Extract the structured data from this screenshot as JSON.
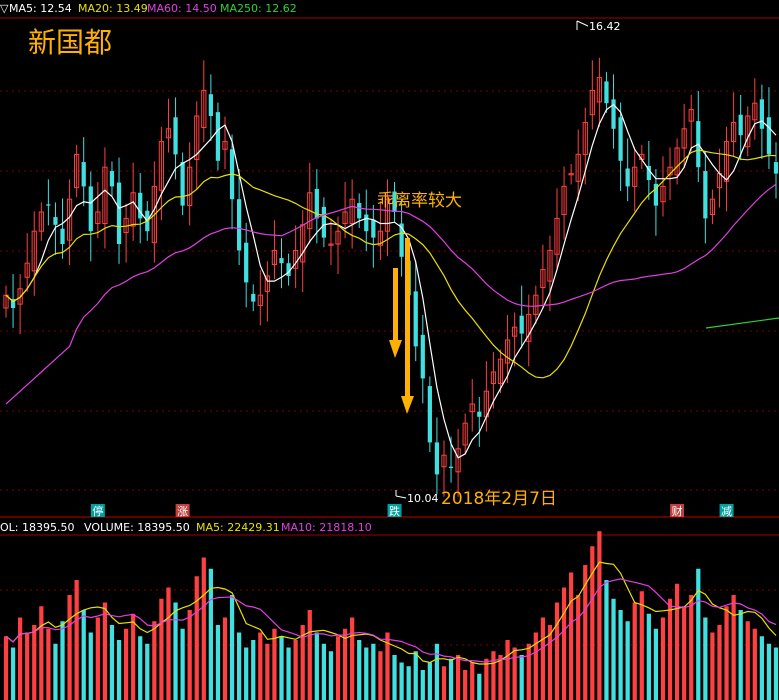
{
  "stock_name": "新国都",
  "annotations": {
    "deviation_note": "乖离率较大",
    "date_note": "2018年2月7日",
    "high_label": "16.42",
    "low_label": "10.04"
  },
  "price_header": {
    "prefix": "▽",
    "ma5": "MA5: 12.54",
    "ma20": "MA20: 13.49",
    "ma60": "MA60: 14.50",
    "ma250": "MA250: 12.62"
  },
  "volume_header": {
    "vol": "OL: 18395.50",
    "volume": "VOLUME: 18395.50",
    "ma5": "MA5: 22429.31",
    "ma10": "MA10: 21818.10"
  },
  "event_badges": [
    {
      "label": "停",
      "color": "#00a0a0",
      "day": 13
    },
    {
      "label": "涨",
      "color": "#c04040",
      "day": 25
    },
    {
      "label": "跌",
      "color": "#00a0a0",
      "day": 55
    },
    {
      "label": "财",
      "color": "#c04040",
      "day": 95
    },
    {
      "label": "减",
      "color": "#00a0a0",
      "day": 102
    }
  ],
  "colors": {
    "up": "#ff4040",
    "down": "#40e0e0",
    "ma5": "#ffffff",
    "ma20": "#e8e000",
    "ma60": "#e040e0",
    "ma250": "#30d030",
    "accent": "#ffb000",
    "axis": "#c00000"
  },
  "chart_data": {
    "type": "candlestick",
    "price_range": [
      9.7,
      17.2
    ],
    "volume_range": [
      0,
      60000
    ],
    "high": 16.42,
    "low": 10.04,
    "closes": [
      12.9,
      12.7,
      13.0,
      13.4,
      13.9,
      14.2,
      14.3,
      14.0,
      13.7,
      14.4,
      15.1,
      14.6,
      13.9,
      14.2,
      14.9,
      14.6,
      13.7,
      14.1,
      14.5,
      14.1,
      13.9,
      14.6,
      15.3,
      15.5,
      15.1,
      14.3,
      14.9,
      15.7,
      16.1,
      15.7,
      15.0,
      15.3,
      14.4,
      13.6,
      13.1,
      12.8,
      12.9,
      13.2,
      13.6,
      13.4,
      13.2,
      13.6,
      14.0,
      14.5,
      14.1,
      13.8,
      13.7,
      13.9,
      14.2,
      14.4,
      14.1,
      13.9,
      13.8,
      13.9,
      14.4,
      14.2,
      13.5,
      12.9,
      12.1,
      11.6,
      10.6,
      10.1,
      10.4,
      10.2,
      10.5,
      10.9,
      11.2,
      11.0,
      11.4,
      11.7,
      11.9,
      12.2,
      12.4,
      12.3,
      12.6,
      12.9,
      13.3,
      13.6,
      14.1,
      14.6,
      14.8,
      15.1,
      15.6,
      16.1,
      16.3,
      15.9,
      15.5,
      15.0,
      14.6,
      14.9,
      15.1,
      14.7,
      14.3,
      14.6,
      14.9,
      15.2,
      15.5,
      15.8,
      14.9,
      14.1,
      14.4,
      14.8,
      15.3,
      15.6,
      15.4,
      15.7,
      15.9,
      15.5,
      15.1,
      14.8
    ],
    "volumes": [
      17,
      14,
      22,
      18,
      20,
      25,
      19,
      15,
      21,
      28,
      32,
      24,
      18,
      22,
      26,
      20,
      16,
      19,
      23,
      17,
      15,
      21,
      27,
      30,
      26,
      19,
      24,
      33,
      38,
      35,
      20,
      22,
      28,
      18,
      14,
      16,
      18,
      15,
      19,
      17,
      14,
      16,
      20,
      24,
      18,
      15,
      13,
      17,
      19,
      22,
      16,
      14,
      15,
      13,
      18,
      12,
      10,
      9,
      13,
      8,
      10,
      15,
      9,
      11,
      12,
      8,
      10,
      7,
      11,
      13,
      12,
      16,
      14,
      12,
      15,
      18,
      22,
      20,
      26,
      30,
      34,
      28,
      36,
      41,
      45,
      32,
      27,
      24,
      21,
      26,
      29,
      23,
      19,
      22,
      27,
      31,
      25,
      28,
      35,
      22,
      18,
      20,
      25,
      28,
      24,
      21,
      19,
      17,
      15,
      14
    ]
  }
}
